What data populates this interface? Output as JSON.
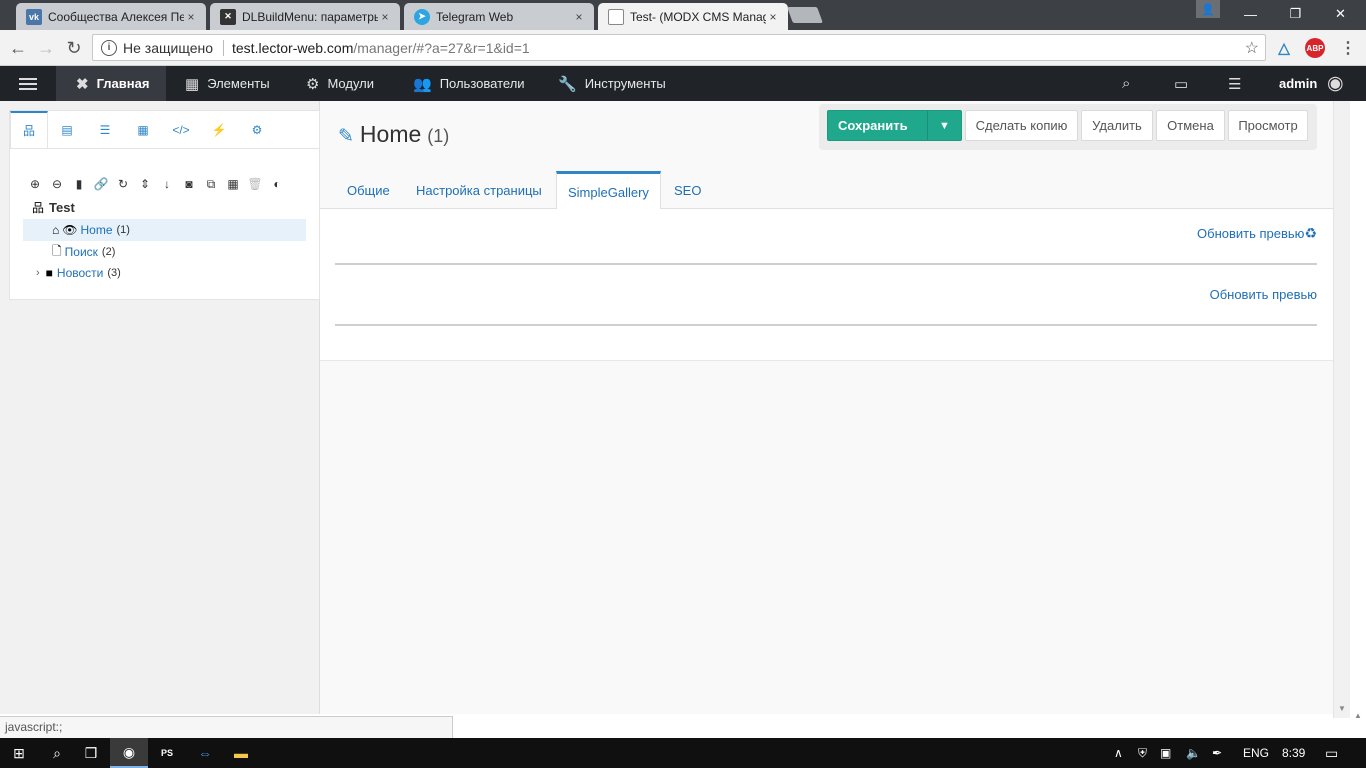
{
  "browser": {
    "tabs": [
      {
        "title": "Сообщества Алексея Пе",
        "favicon": "vk-icon",
        "favicon_color": "#4a76a8",
        "active": false
      },
      {
        "title": "DLBuildMenu: параметры",
        "favicon": "modx-icon",
        "favicon_color": "#333333",
        "active": false
      },
      {
        "title": "Telegram Web",
        "favicon": "telegram-icon",
        "favicon_color": "#2ca5e0",
        "active": false
      },
      {
        "title": "Test- (MODX CMS Manag",
        "favicon": "page-icon",
        "favicon_color": "#ffffff",
        "active": true
      }
    ],
    "close_glyph": "×",
    "security_label": "Не защищено",
    "url_host": "test.lector-web.com",
    "url_path": "/manager/#?a=27&r=1&id=1",
    "ext_abp": "ABP"
  },
  "modx_nav": {
    "items": [
      {
        "label": "Главная",
        "icon": "modx-logo-icon"
      },
      {
        "label": "Элементы",
        "icon": "grid-icon"
      },
      {
        "label": "Модули",
        "icon": "cogs-icon"
      },
      {
        "label": "Пользователи",
        "icon": "users-icon"
      },
      {
        "label": "Инструменты",
        "icon": "wrench-icon"
      }
    ],
    "user": "admin"
  },
  "tree": {
    "root": "Test",
    "nodes": [
      {
        "label": "Home",
        "count": "(1)",
        "icon": "home-icon"
      },
      {
        "label": "Поиск",
        "count": "(2)",
        "icon": "page-icon"
      },
      {
        "label": "Новости",
        "count": "(3)",
        "icon": "folder-icon"
      }
    ]
  },
  "page": {
    "title": "Home",
    "id": "(1)",
    "buttons": {
      "save": "Сохранить",
      "duplicate": "Сделать копию",
      "delete": "Удалить",
      "cancel": "Отмена",
      "view": "Просмотр"
    },
    "tabs": [
      "Общие",
      "Настройка страницы",
      "SimpleGallery",
      "SEO"
    ],
    "active_tab": "SimpleGallery",
    "refresh_1": "Обновить превью",
    "refresh_2": "Обновить превью"
  },
  "statusbar": "javascript:;",
  "taskbar": {
    "lang": "ENG",
    "time": "8:39"
  },
  "colors": {
    "accent": "#2f86c4",
    "save_green": "#20a88d",
    "nav_dark": "#202328"
  }
}
